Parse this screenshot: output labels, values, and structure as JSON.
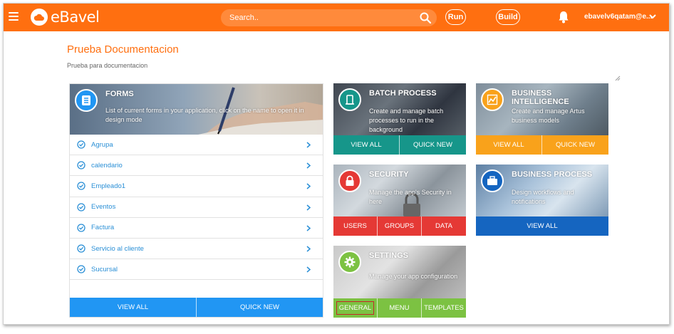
{
  "app": {
    "name": "eBavel"
  },
  "topbar": {
    "search_placeholder": "Search..",
    "run_label": "Run",
    "build_label": "Build",
    "user": "ebavelv6qatam@e..."
  },
  "page": {
    "title": "Prueba Documentacion",
    "subtitle": "Prueba para documentacion"
  },
  "forms": {
    "title": "FORMS",
    "description": "List of current forms in your application, click on the name to open it in design mode",
    "items": [
      "Agrupa",
      "calendario",
      "Empleado1",
      "Eventos",
      "Factura",
      "Servicio al cliente",
      "Sucursal"
    ],
    "buttons": [
      "VIEW ALL",
      "QUICK NEW"
    ]
  },
  "batch_process": {
    "title": "BATCH PROCESS",
    "description": "Create and manage batch processes to run in the background",
    "buttons": [
      "VIEW ALL",
      "QUICK NEW"
    ]
  },
  "business_intelligence": {
    "title": "BUSINESS INTELLIGENCE",
    "description": "Create and manage Artus business models",
    "buttons": [
      "VIEW ALL",
      "QUICK NEW"
    ]
  },
  "security": {
    "title": "SECURITY",
    "description": "Manage the app's Security in here",
    "buttons": [
      "USERS",
      "GROUPS",
      "DATA"
    ]
  },
  "business_process": {
    "title": "BUSINESS PROCESS",
    "description": "Design workflows and notifications",
    "buttons": [
      "VIEW ALL"
    ]
  },
  "settings": {
    "title": "SETTINGS",
    "description": "Manage your app configuration",
    "buttons": [
      "GENERAL",
      "MENU",
      "TEMPLATES"
    ]
  },
  "colors": {
    "brand": "#ff6f10",
    "forms": "#2196f3",
    "batch": "#16968a",
    "bi": "#f9a21b",
    "security": "#e53935",
    "business_process": "#1565c0",
    "settings": "#7cc242"
  },
  "icons": [
    "menu-icon",
    "cloud-logo-icon",
    "search-icon",
    "bell-icon",
    "chevron-down-icon",
    "document-icon",
    "batch-icon",
    "chart-icon",
    "lock-icon",
    "briefcase-icon",
    "gear-icon",
    "check-circle-icon",
    "chevron-right-icon"
  ]
}
